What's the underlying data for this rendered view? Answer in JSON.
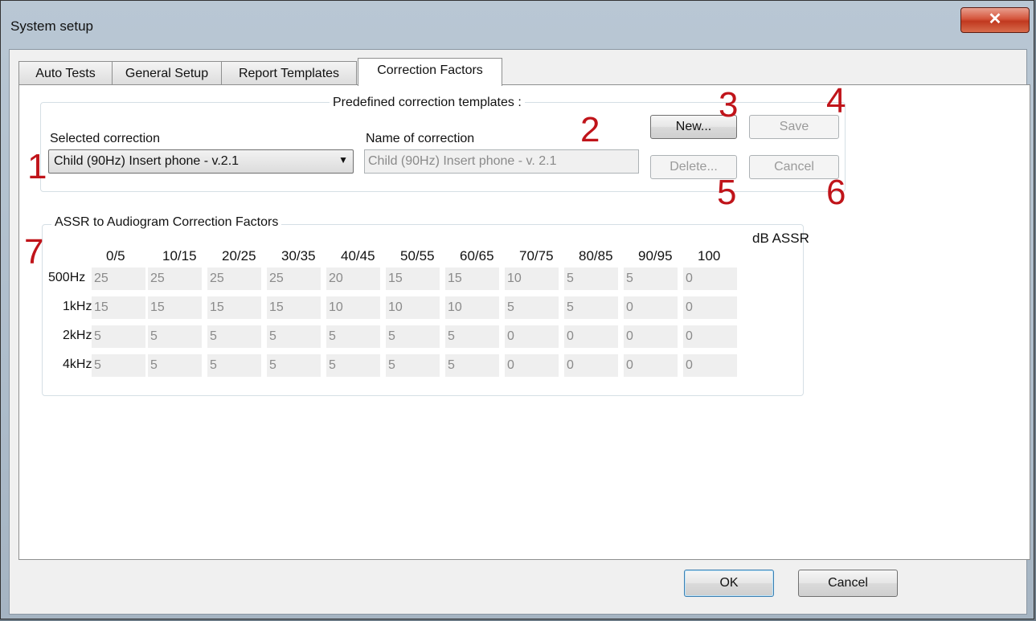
{
  "window": {
    "title": "System setup",
    "close_glyph": "✕"
  },
  "tabs": [
    "Auto Tests",
    "General Setup",
    "Report Templates",
    "Correction Factors"
  ],
  "active_tab": "Correction Factors",
  "templates": {
    "group_label": "Predefined correction templates :",
    "selected_label": "Selected correction",
    "selected_value": "Child (90Hz) Insert phone - v.2.1",
    "name_label": "Name of correction",
    "name_value": "Child (90Hz) Insert phone - v. 2.1",
    "buttons": {
      "new": "New...",
      "save": "Save",
      "delete": "Delete...",
      "cancel": "Cancel"
    }
  },
  "table": {
    "group_label": "ASSR to Audiogram Correction Factors",
    "unit_label": "dB ASSR",
    "columns": [
      "0/5",
      "10/15",
      "20/25",
      "30/35",
      "40/45",
      "50/55",
      "60/65",
      "70/75",
      "80/85",
      "90/95",
      "100"
    ],
    "rows": [
      {
        "label": "500Hz",
        "values": [
          "25",
          "25",
          "25",
          "25",
          "20",
          "15",
          "15",
          "10",
          "5",
          "5",
          "0"
        ]
      },
      {
        "label": "1kHz",
        "values": [
          "15",
          "15",
          "15",
          "15",
          "10",
          "10",
          "10",
          "5",
          "5",
          "0",
          "0"
        ]
      },
      {
        "label": "2kHz",
        "values": [
          "5",
          "5",
          "5",
          "5",
          "5",
          "5",
          "5",
          "0",
          "0",
          "0",
          "0"
        ]
      },
      {
        "label": "4kHz",
        "values": [
          "5",
          "5",
          "5",
          "5",
          "5",
          "5",
          "5",
          "0",
          "0",
          "0",
          "0"
        ]
      }
    ]
  },
  "callouts": [
    "1",
    "2",
    "3",
    "4",
    "5",
    "6",
    "7"
  ],
  "footer": {
    "ok": "OK",
    "cancel": "Cancel"
  },
  "colors": {
    "callout": "#c0141a",
    "ok_focus": "#3c7fb1"
  }
}
